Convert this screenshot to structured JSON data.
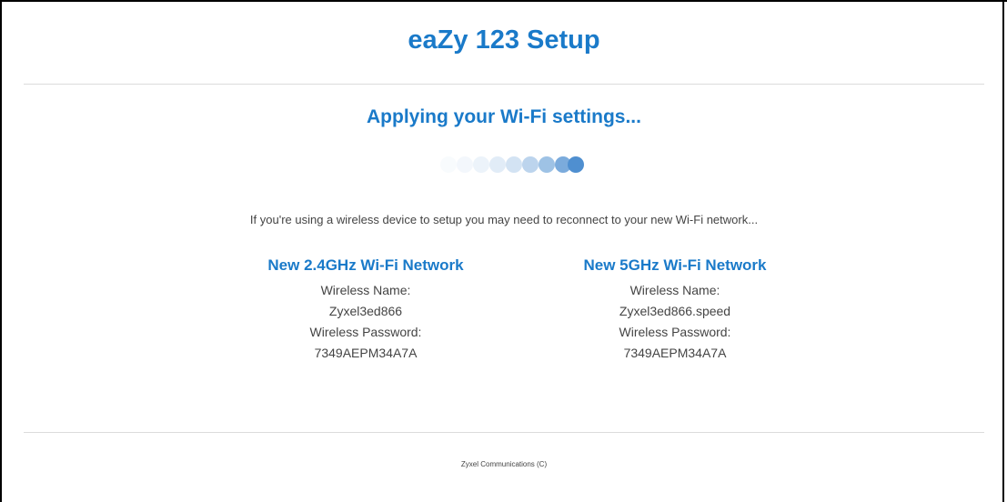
{
  "header": {
    "title": "eaZy 123 Setup"
  },
  "main": {
    "status_heading": "Applying your Wi-Fi settings...",
    "spinner_icon": "loading-dots-icon",
    "notice": "If you're using a wireless device to setup you may need to reconnect to your new Wi-Fi network...",
    "networks": [
      {
        "title": "New 2.4GHz Wi-Fi Network",
        "name_label": "Wireless Name:",
        "name_value": "Zyxel3ed866",
        "password_label": "Wireless Password:",
        "password_value": "7349AEPM34A7A"
      },
      {
        "title": "New 5GHz Wi-Fi Network",
        "name_label": "Wireless Name:",
        "name_value": "Zyxel3ed866.speed",
        "password_label": "Wireless Password:",
        "password_value": "7349AEPM34A7A"
      }
    ]
  },
  "footer": {
    "copyright": "Zyxel Communications (C)"
  },
  "colors": {
    "accent": "#1a7ac9",
    "text": "#444444",
    "spinner": "#4f8fd0"
  }
}
